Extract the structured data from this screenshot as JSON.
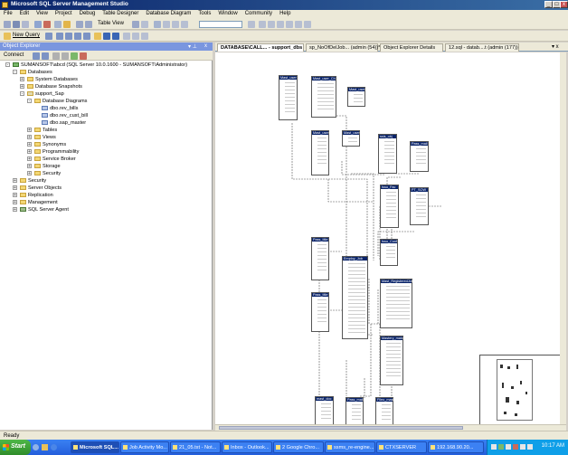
{
  "window": {
    "title": "Microsoft SQL Server Management Studio",
    "buttons": [
      "_",
      "□",
      "x"
    ]
  },
  "menu": [
    "File",
    "Edit",
    "View",
    "Project",
    "Debug",
    "Table Designer",
    "Database Diagram",
    "Tools",
    "Window",
    "Community",
    "Help"
  ],
  "toolbar": {
    "new_query": "New Query",
    "table_view": "Table View"
  },
  "object_explorer": {
    "title": "Object Explorer",
    "connect": "Connect",
    "tree": [
      {
        "label": "SUMANSOFT\\abcd (SQL Server 10.0.1600 - SUMANSOFT\\Administrator)",
        "level": 0,
        "exp": "-"
      },
      {
        "label": "Databases",
        "level": 1,
        "exp": "-"
      },
      {
        "label": "System Databases",
        "level": 2,
        "exp": "+"
      },
      {
        "label": "Database Snapshots",
        "level": 2,
        "exp": "+"
      },
      {
        "label": "support_Sap",
        "level": 2,
        "exp": "-"
      },
      {
        "label": "Database Diagrams",
        "level": 3,
        "exp": "-"
      },
      {
        "label": "dbo.rev_bills",
        "level": 4,
        "exp": ""
      },
      {
        "label": "dbo.rev_cust_bill",
        "level": 4,
        "exp": ""
      },
      {
        "label": "dbo.sap_master",
        "level": 4,
        "exp": ""
      },
      {
        "label": "Tables",
        "level": 3,
        "exp": "+"
      },
      {
        "label": "Views",
        "level": 3,
        "exp": "+"
      },
      {
        "label": "Synonyms",
        "level": 3,
        "exp": "+"
      },
      {
        "label": "Programmability",
        "level": 3,
        "exp": "+"
      },
      {
        "label": "Service Broker",
        "level": 3,
        "exp": "+"
      },
      {
        "label": "Storage",
        "level": 3,
        "exp": "+"
      },
      {
        "label": "Security",
        "level": 3,
        "exp": "+"
      },
      {
        "label": "Security",
        "level": 1,
        "exp": "+"
      },
      {
        "label": "Server Objects",
        "level": 1,
        "exp": "+"
      },
      {
        "label": "Replication",
        "level": 1,
        "exp": "+"
      },
      {
        "label": "Management",
        "level": 1,
        "exp": "+"
      },
      {
        "label": "SQL Server Agent",
        "level": 1,
        "exp": "+"
      }
    ]
  },
  "tabs": [
    "DATABASE\\CALL... - support_dbs",
    "sp_NoOfDelJob... (admin (54))*",
    "Object Explorer Details",
    "12.sql - datab....t (admin (177))"
  ],
  "diagram_tables": [
    "Mast_user",
    "Mast_user_Ch",
    "Mast_user",
    "Mast_user",
    "Mast_user",
    "ssis_obj",
    "Pass_mail",
    "Issu_Fac",
    "PT_SOW",
    "Pass_title",
    "Issu_Conf",
    "Employ_Job",
    "Pass_title",
    "Mast_RegisteredJob",
    "Mastery_match",
    "mast_doc",
    "Pass_mail",
    "Fileo_mast"
  ],
  "status": "Ready",
  "taskbar": {
    "start": "Start",
    "tasks": [
      "Microsoft SQL...",
      "Job Activity Mo...",
      "21_05.txt - Not...",
      "Inbox - Outlook...",
      "2 Google Chro...",
      "ssms_re-engine...",
      "CTXSERVER",
      "192.168.90.20..."
    ],
    "clock": "10:17 AM"
  },
  "colors": {
    "titlebar": "#0a246a",
    "taskbar": "#245edb",
    "start": "#2f8c2a",
    "table_header": "#0a246a"
  }
}
